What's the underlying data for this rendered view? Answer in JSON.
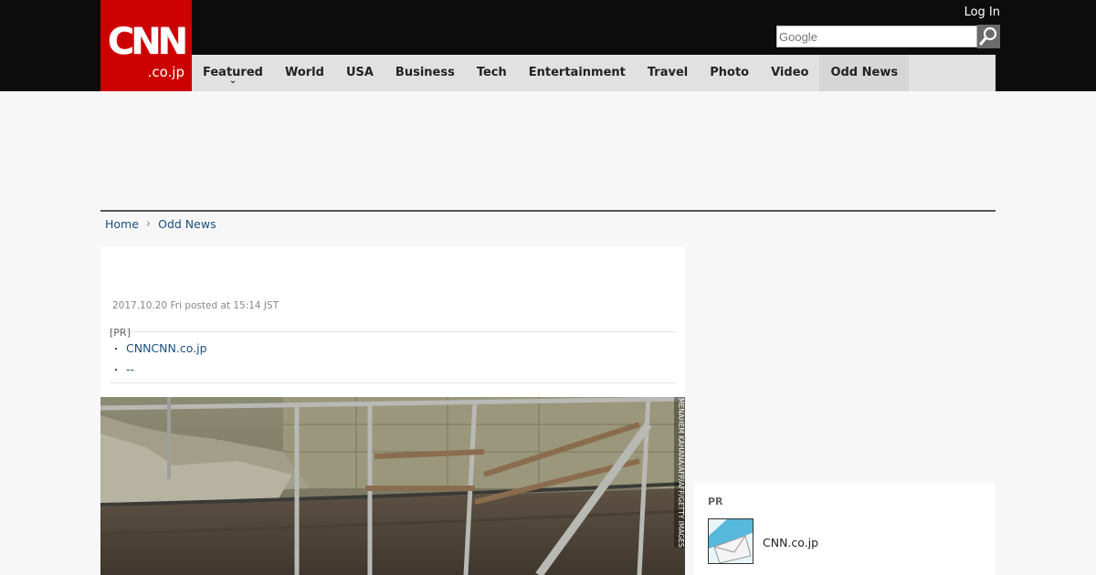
{
  "header": {
    "logo_main": "CNN",
    "logo_sub": ".co.jp",
    "login_label": "Log In",
    "search_placeholder": "Google"
  },
  "nav": {
    "items": [
      {
        "label": "Featured"
      },
      {
        "label": "World"
      },
      {
        "label": "USA"
      },
      {
        "label": "Business"
      },
      {
        "label": "Tech"
      },
      {
        "label": "Entertainment"
      },
      {
        "label": "Travel"
      },
      {
        "label": "Photo"
      },
      {
        "label": "Video"
      },
      {
        "label": "Odd News"
      }
    ],
    "active_label": "Odd News"
  },
  "breadcrumb": {
    "home": "Home",
    "current": "Odd News"
  },
  "article": {
    "date": "2017.10.20 Fri posted at 15:14 JST",
    "pr_label": "[PR]",
    "pr_links": [
      "CNNCNN.co.jp",
      "--"
    ],
    "photo_credit": "MENAHEM KAHANA/AFP/AFP/GETTY IMAGES"
  },
  "sidebar": {
    "pr_label": "PR",
    "item_text": "CNN.co.jp"
  },
  "colors": {
    "brand_red": "#cc0000",
    "link_blue": "#1a4f7e",
    "topbar": "#0c0c0c",
    "nav_bg": "#e1e1e1"
  }
}
